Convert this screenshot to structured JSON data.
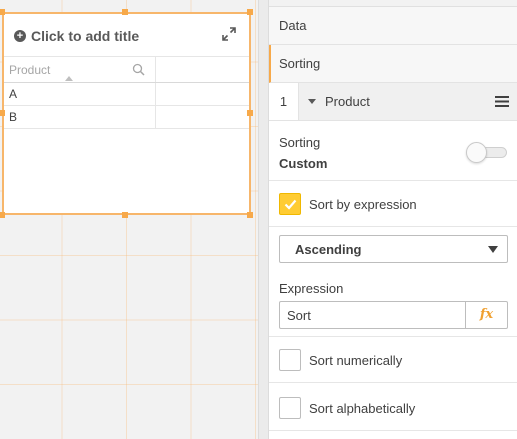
{
  "table_object": {
    "title_placeholder": "Click to add title",
    "column_header": "Product",
    "rows": [
      "A",
      "B"
    ]
  },
  "properties": {
    "sections": [
      "Data",
      "Sorting"
    ],
    "sort_field": {
      "index": "1",
      "name": "Product"
    },
    "sorting": {
      "label": "Sorting",
      "value": "Custom",
      "toggle_on": false
    },
    "sort_by_expression": {
      "label": "Sort by expression",
      "checked": true
    },
    "order_dropdown": {
      "selected": "Ascending"
    },
    "expression": {
      "label": "Expression",
      "value": "Sort",
      "fx_label": "fx"
    },
    "sort_numerically": {
      "label": "Sort numerically",
      "checked": false
    },
    "sort_alphabetically": {
      "label": "Sort alphabetically",
      "checked": false
    }
  },
  "colors": {
    "accent": "#f7a94a",
    "checkbox_on": "#ffcc33",
    "fx": "#f0a030"
  },
  "icons": [
    "plus-circle-icon",
    "expand-icon",
    "search-icon",
    "sort-ascending-icon",
    "caret-down-icon",
    "hamburger-menu-icon",
    "checkmark-icon",
    "fx-icon"
  ]
}
